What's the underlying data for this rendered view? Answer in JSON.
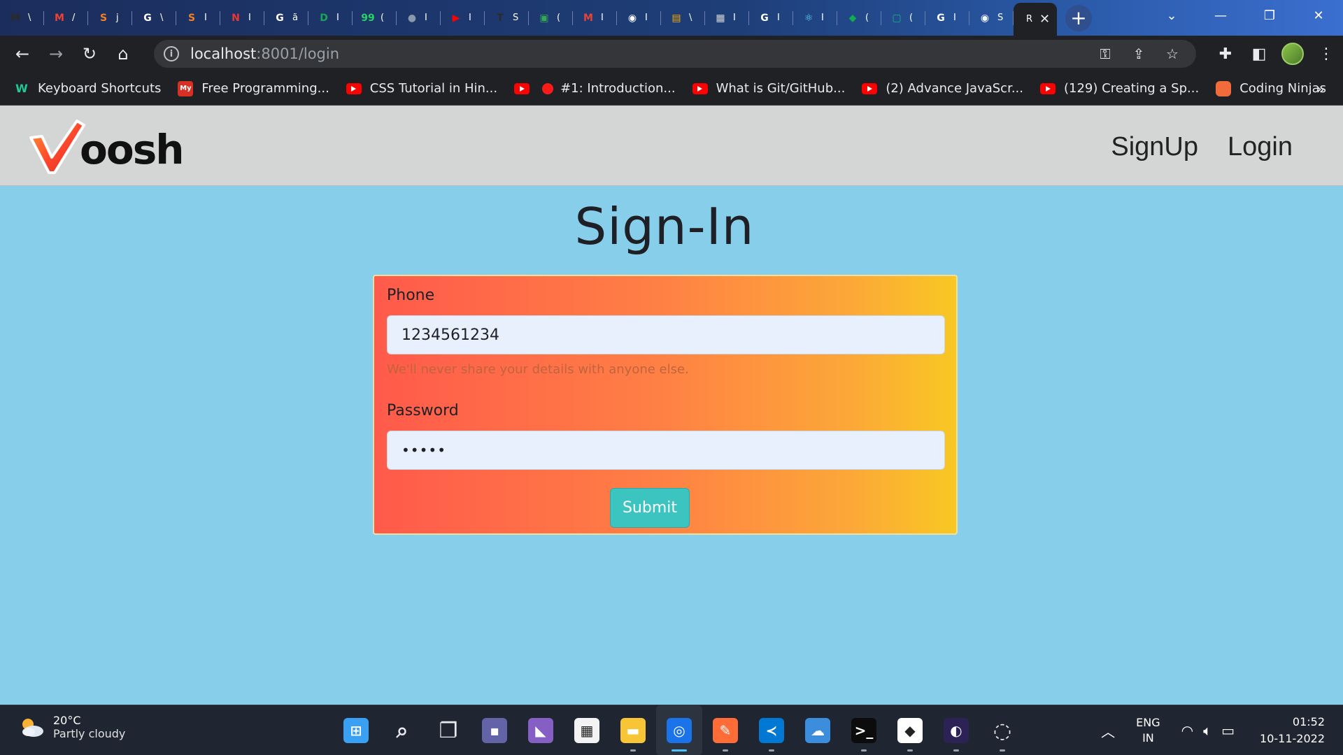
{
  "browser": {
    "tabs": [
      {
        "icon": "m-icon",
        "letter": "\\",
        "color": "#2b2b2b",
        "glyph": "M"
      },
      {
        "icon": "gmail-icon",
        "letter": "/",
        "color": "#ea4335",
        "glyph": "M"
      },
      {
        "icon": "stackoverflow-icon",
        "letter": "j",
        "color": "#f48024",
        "glyph": "S"
      },
      {
        "icon": "google-icon",
        "letter": "\\",
        "color": "#ffffff",
        "glyph": "G"
      },
      {
        "icon": "stackoverflow-icon",
        "letter": "I",
        "color": "#f48024",
        "glyph": "S"
      },
      {
        "icon": "bookmark-icon",
        "letter": "I",
        "color": "#e53935",
        "glyph": "N"
      },
      {
        "icon": "google-icon",
        "letter": "ã",
        "color": "#ffffff",
        "glyph": "G"
      },
      {
        "icon": "shield-icon",
        "letter": "I",
        "color": "#19a35b",
        "glyph": "D"
      },
      {
        "icon": "whatsapp-icon",
        "letter": "(",
        "color": "#25d366",
        "glyph": "99"
      },
      {
        "icon": "globe-icon",
        "letter": "I",
        "color": "#8a98ad",
        "glyph": "●"
      },
      {
        "icon": "youtube-icon",
        "letter": "I",
        "color": "#ff0000",
        "glyph": "▶"
      },
      {
        "icon": "t-icon",
        "letter": "S",
        "color": "#2b2b2b",
        "glyph": "T"
      },
      {
        "icon": "meet-icon",
        "letter": "(",
        "color": "#34a853",
        "glyph": "▣"
      },
      {
        "icon": "gmail-icon",
        "letter": "I",
        "color": "#ea4335",
        "glyph": "M"
      },
      {
        "icon": "github-icon",
        "letter": "I",
        "color": "#ffffff",
        "glyph": "◉"
      },
      {
        "icon": "notes-icon",
        "letter": "\\",
        "color": "#f9ab00",
        "glyph": "▤"
      },
      {
        "icon": "doc-icon",
        "letter": "I",
        "color": "#d7d7d7",
        "glyph": "▦"
      },
      {
        "icon": "google-icon",
        "letter": "I",
        "color": "#ffffff",
        "glyph": "G"
      },
      {
        "icon": "react-icon",
        "letter": "I",
        "color": "#61dafb",
        "glyph": "⚛"
      },
      {
        "icon": "mongodb-icon",
        "letter": "(",
        "color": "#13aa52",
        "glyph": "◆"
      },
      {
        "icon": "screen-icon",
        "letter": "(",
        "color": "#10b981",
        "glyph": "▢"
      },
      {
        "icon": "google-icon",
        "letter": "I",
        "color": "#ffffff",
        "glyph": "G"
      },
      {
        "icon": "github-icon",
        "letter": "S",
        "color": "#ffffff",
        "glyph": "◉"
      }
    ],
    "active_tab_letter": "R",
    "address_host": "localhost",
    "address_path": ":8001/login",
    "bookmarks": [
      {
        "label": "Keyboard Shortcuts",
        "icon": "w-icon",
        "kind": "w"
      },
      {
        "label": "Free Programming...",
        "icon": "my-icon",
        "kind": "my"
      },
      {
        "label": "CSS Tutorial in Hin...",
        "icon": "youtube-icon",
        "kind": "yt"
      },
      {
        "label": "#1: Introduction...",
        "icon": "youtube-icon",
        "kind": "yt-dot"
      },
      {
        "label": "What is Git/GitHub...",
        "icon": "youtube-icon",
        "kind": "yt"
      },
      {
        "label": "(2) Advance JavaScr...",
        "icon": "youtube-icon",
        "kind": "yt"
      },
      {
        "label": "(129) Creating a Sp...",
        "icon": "youtube-icon",
        "kind": "yt"
      },
      {
        "label": "Coding Ninjas",
        "icon": "coding-ninjas-icon",
        "kind": "cn"
      }
    ],
    "bookmarks_more": "»"
  },
  "site": {
    "logo_text": "oosh",
    "nav": [
      "SignUp",
      "Login"
    ]
  },
  "page": {
    "title": "Sign-In",
    "phone_label": "Phone",
    "phone_value": "1234561234",
    "help_text": "We'll never share your details with anyone else.",
    "password_label": "Password",
    "password_value": "•••••",
    "submit_label": "Submit"
  },
  "taskbar": {
    "weather_temp": "20°C",
    "weather_desc": "Partly cloudy",
    "lang_top": "ENG",
    "lang_bottom": "IN",
    "time": "01:52",
    "date": "10-11-2022",
    "apps": [
      {
        "icon": "windows-start-icon",
        "color": "#3aa0f3",
        "glyph": "⊞",
        "dot": false
      },
      {
        "icon": "search-icon",
        "color": "transparent",
        "glyph": "⌕",
        "dot": false
      },
      {
        "icon": "task-view-icon",
        "color": "transparent",
        "glyph": "❐",
        "dot": false
      },
      {
        "icon": "teams-chat-icon",
        "color": "#6264a7",
        "glyph": "▪",
        "dot": false
      },
      {
        "icon": "visual-studio-icon",
        "color": "#865fc5",
        "glyph": "◣",
        "dot": false
      },
      {
        "icon": "microsoft-store-icon",
        "color": "#f3f3f3",
        "glyph": "▦",
        "dot": false
      },
      {
        "icon": "file-explorer-icon",
        "color": "#f8c537",
        "glyph": "▬",
        "dot": true
      },
      {
        "icon": "chrome-icon",
        "color": "#1a73e8",
        "glyph": "◎",
        "dot": true,
        "active": true
      },
      {
        "icon": "pen-app-icon",
        "color": "#ff6c37",
        "glyph": "✎",
        "dot": true
      },
      {
        "icon": "vscode-icon",
        "color": "#0078d4",
        "glyph": "≺",
        "dot": true
      },
      {
        "icon": "cloud-app-icon",
        "color": "#3c8ddc",
        "glyph": "☁",
        "dot": false
      },
      {
        "icon": "terminal-icon",
        "color": "#0c0c0c",
        "glyph": ">_",
        "dot": true
      },
      {
        "icon": "mongodb-compass-icon",
        "color": "#ffffff",
        "glyph": "◆",
        "dot": true
      },
      {
        "icon": "eclipse-icon",
        "color": "#2c2255",
        "glyph": "◐",
        "dot": true
      },
      {
        "icon": "obs-icon",
        "color": "transparent",
        "glyph": "◌",
        "dot": true
      }
    ]
  }
}
